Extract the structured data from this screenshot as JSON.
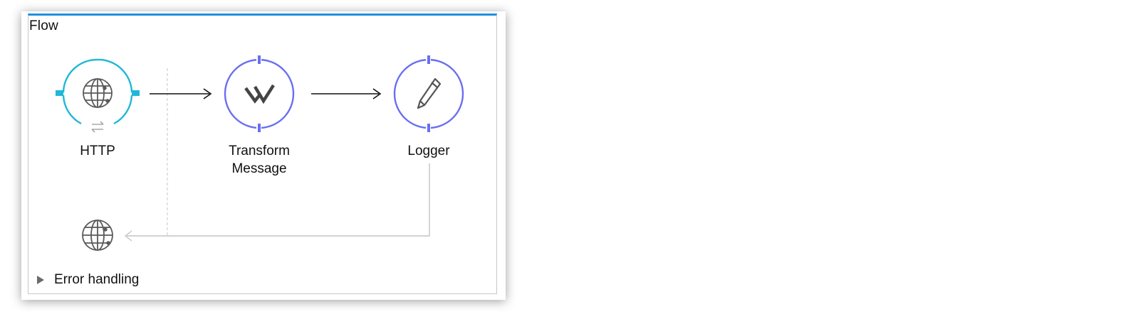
{
  "flow": {
    "title": "Flow",
    "accent_color": "#1f8fe0"
  },
  "nodes": [
    {
      "id": "http",
      "label": "HTTP",
      "icon": "globe-icon",
      "color": "#1fb8d6"
    },
    {
      "id": "transform",
      "label": "Transform\nMessage",
      "icon": "dataweave-icon",
      "color": "#6a6ff0"
    },
    {
      "id": "logger",
      "label": "Logger",
      "icon": "pencil-icon",
      "color": "#6a6ff0"
    }
  ],
  "response": {
    "icon": "globe-icon"
  },
  "error_handling": {
    "label": "Error handling",
    "expanded": false
  }
}
